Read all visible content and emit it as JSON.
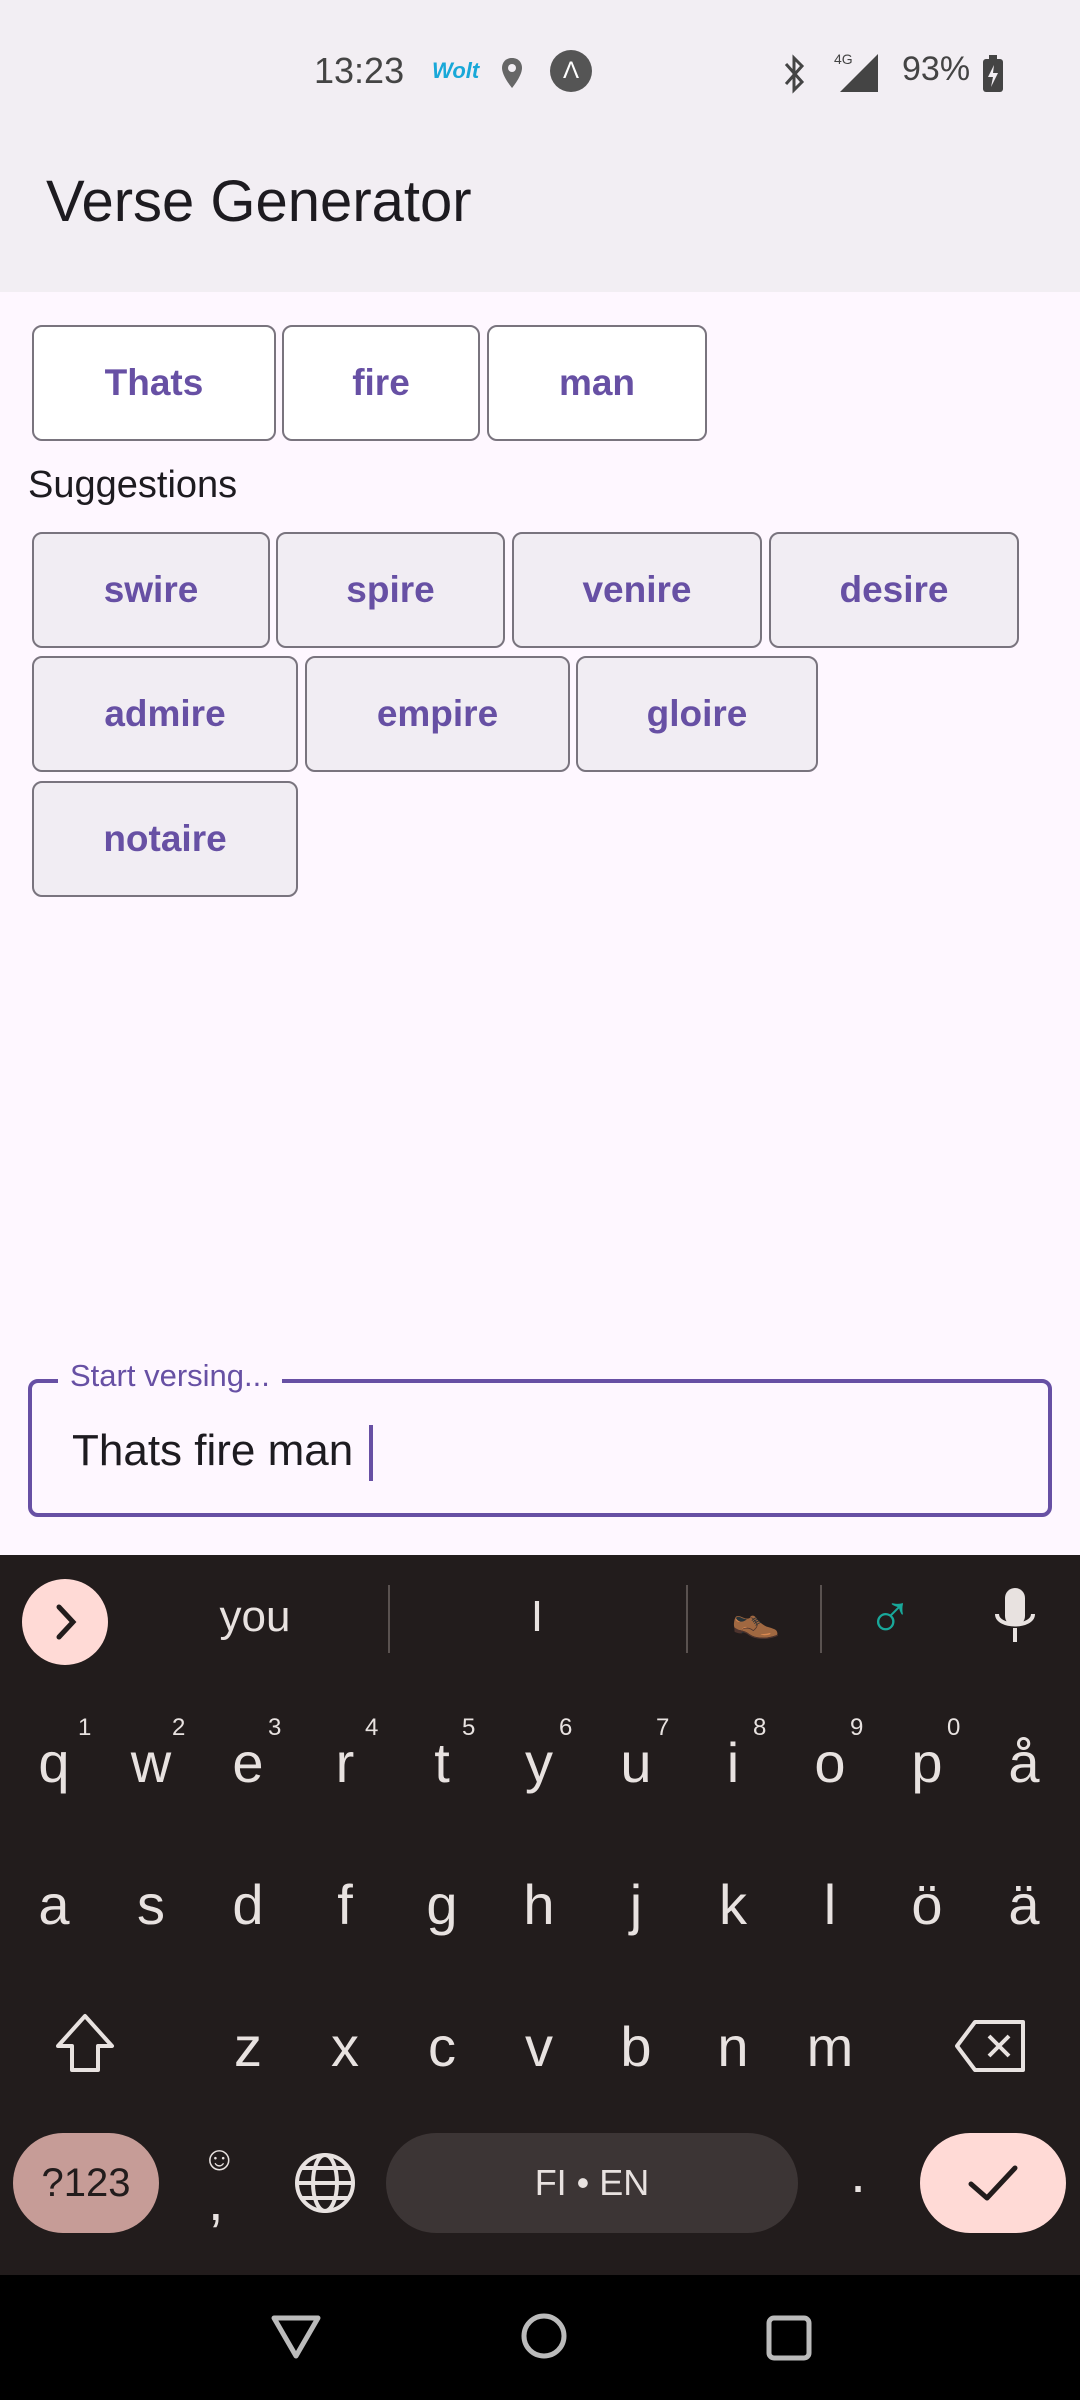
{
  "status_bar": {
    "time": "13:23",
    "wolt_label": "Wolt",
    "avatar_letter": "Λ",
    "battery": "93%",
    "network": "4G"
  },
  "app": {
    "title": "Verse Generator"
  },
  "words": [
    "Thats",
    "fire",
    "man"
  ],
  "suggestions_label": "Suggestions",
  "suggestions": [
    "swire",
    "spire",
    "venire",
    "desire",
    "admire",
    "empire",
    "gloire",
    "notaire"
  ],
  "input": {
    "label": "Start versing...",
    "value": "Thats fire man"
  },
  "keyboard": {
    "suggestions": [
      "you",
      "I",
      "👞",
      "♂"
    ],
    "row1": [
      "q",
      "w",
      "e",
      "r",
      "t",
      "y",
      "u",
      "i",
      "o",
      "p",
      "å"
    ],
    "row1_hints": [
      "1",
      "2",
      "3",
      "4",
      "5",
      "6",
      "7",
      "8",
      "9",
      "0"
    ],
    "row2": [
      "a",
      "s",
      "d",
      "f",
      "g",
      "h",
      "j",
      "k",
      "l",
      "ö",
      "ä"
    ],
    "row3": [
      "z",
      "x",
      "c",
      "v",
      "b",
      "n",
      "m"
    ],
    "symbols_label": "?123",
    "comma": ",",
    "emoji_hint": "☺",
    "space_label": "FI • EN",
    "period": "."
  },
  "colors": {
    "accent": "#6750a4",
    "chip_fill": "#f1edf3",
    "keyboard_bg": "#221c1c",
    "enter_fill": "#ffdad6",
    "symbols_fill": "#c69c97"
  }
}
